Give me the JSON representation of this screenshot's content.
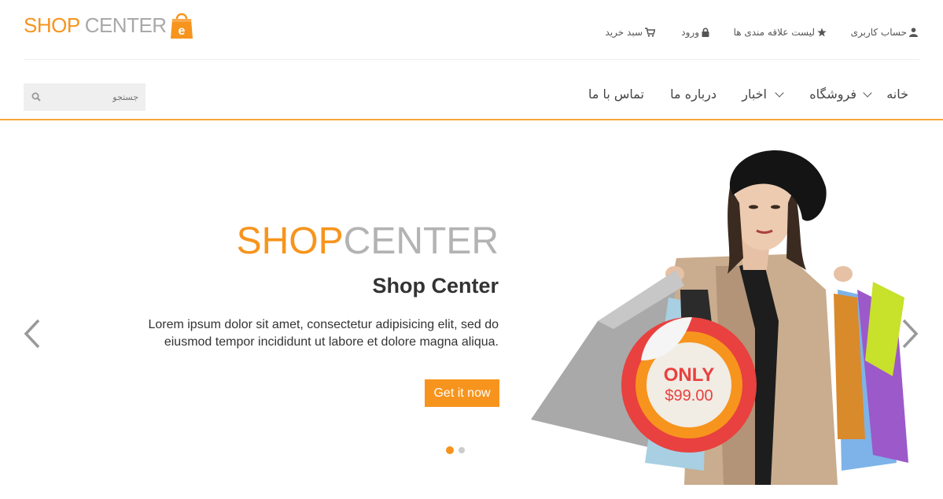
{
  "logo": {
    "shop": "SHOP",
    "center": "CENTER",
    "bag_letter": "e"
  },
  "topnav": {
    "account": "حساب کاربری",
    "wishlist": "لیست علاقه مندی ها",
    "login": "ورود",
    "cart": "سبد خرید"
  },
  "mainnav": {
    "home": "خانه",
    "shop": "فروشگاه",
    "news": "اخبار",
    "about": "درباره ما",
    "contact": "تماس با ما"
  },
  "search": {
    "placeholder": "جستجو"
  },
  "slide": {
    "brand_shop": "SHOP",
    "brand_center": "CENTER",
    "subtitle": "Shop Center",
    "description": "Lorem ipsum dolor sit amet, consectetur adipisicing elit, sed do eiusmod tempor incididunt ut labore et dolore magna aliqua.",
    "button": "Get it now",
    "badge_top": "ONLY",
    "badge_price": "$99.00",
    "active_slide": 1,
    "slide_count": 2
  },
  "colors": {
    "accent": "#f7941d",
    "gray": "#b3b3b3",
    "badge_red": "#e8413f"
  }
}
